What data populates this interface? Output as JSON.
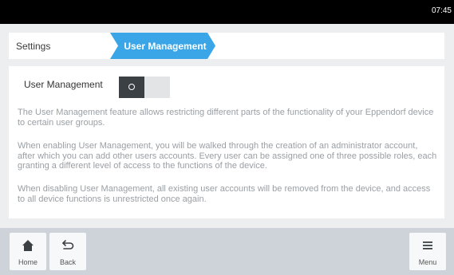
{
  "status_bar": {
    "time": "07:45"
  },
  "breadcrumb": {
    "items": [
      {
        "label": "Settings"
      },
      {
        "label": "User Management"
      }
    ]
  },
  "setting": {
    "label": "User Management",
    "toggle_state": "off"
  },
  "description": [
    "The User Management feature allows restricting different parts of the functionality of your Eppendorf device to certain user groups.",
    "When enabling User Management, you will be walked through the creation of an administrator account, after which you can add other users accounts. Every user can be assigned one of three possible roles, each granting a different level of access to the functions of the device.",
    "When disabling User Management, all existing user accounts will be removed from the device, and access to all device functions is unrestricted once again."
  ],
  "bottom_bar": {
    "home_label": "Home",
    "back_label": "Back",
    "menu_label": "Menu"
  },
  "icons": {
    "home": "home-icon",
    "back": "back-arrow-icon",
    "menu": "hamburger-menu-icon",
    "toggle_knob": "circle-icon"
  },
  "colors": {
    "accent": "#3aa6e8",
    "status_bar": "#000000",
    "toggle_knob": "#3b4044",
    "bottom_bar": "#cdd3d8"
  }
}
